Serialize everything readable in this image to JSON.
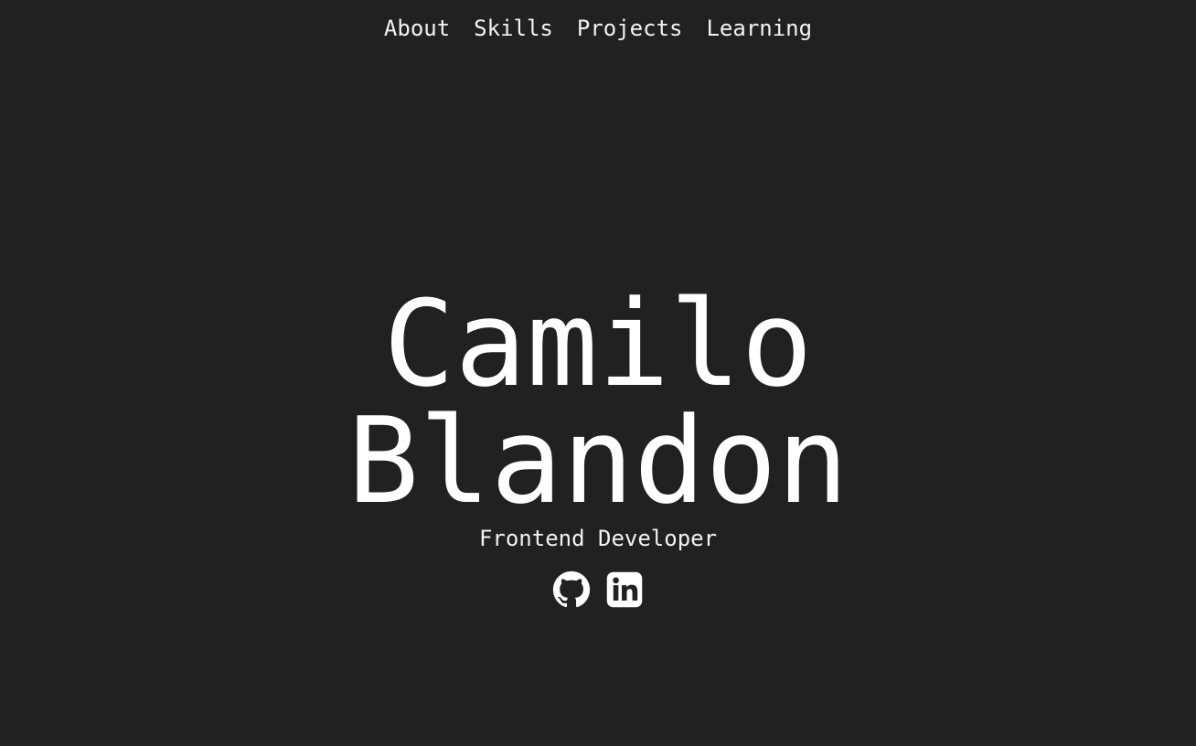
{
  "nav": {
    "items": [
      {
        "label": "About"
      },
      {
        "label": "Skills"
      },
      {
        "label": "Projects"
      },
      {
        "label": "Learning"
      }
    ]
  },
  "hero": {
    "first_name": "Camilo",
    "last_name": "Blandon",
    "role": "Frontend Developer"
  },
  "social": {
    "icons": [
      "github-icon",
      "linkedin-icon"
    ]
  },
  "colors": {
    "background": "#212121",
    "text": "#ffffff"
  }
}
